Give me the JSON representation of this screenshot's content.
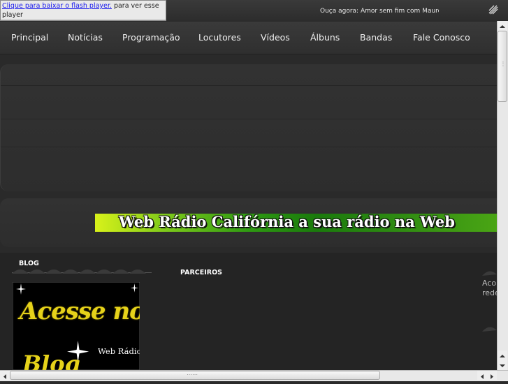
{
  "flash_notice": {
    "link_text": "Clique para baixar o flash player.",
    "suffix": " para ver esse",
    "line2": "player"
  },
  "now_playing": "Ouça agora: Amor sem fim com Mauro",
  "nav": {
    "items": [
      {
        "label": "Principal"
      },
      {
        "label": "Notícias"
      },
      {
        "label": "Programação"
      },
      {
        "label": "Locutores"
      },
      {
        "label": "Vídeos"
      },
      {
        "label": "Álbuns"
      },
      {
        "label": "Bandas"
      },
      {
        "label": "Fale Conosco"
      }
    ]
  },
  "marquee_text": "Web Rádio Califórnia a sua rádio na Web",
  "sections": {
    "blog_title": "BLOG",
    "partners_title": "PARCEIROS",
    "side_text_1": "Aco",
    "side_text_2": "rede"
  },
  "blog_image": {
    "line1": "Acesse nosso",
    "line2": "Web Rádio",
    "line3": "Blog"
  },
  "icons": {
    "logo": "station-logo-icon",
    "scroll_up": "arrow-up-icon",
    "scroll_down": "arrow-down-icon",
    "scroll_left": "arrow-left-icon",
    "scroll_right": "arrow-right-icon"
  }
}
